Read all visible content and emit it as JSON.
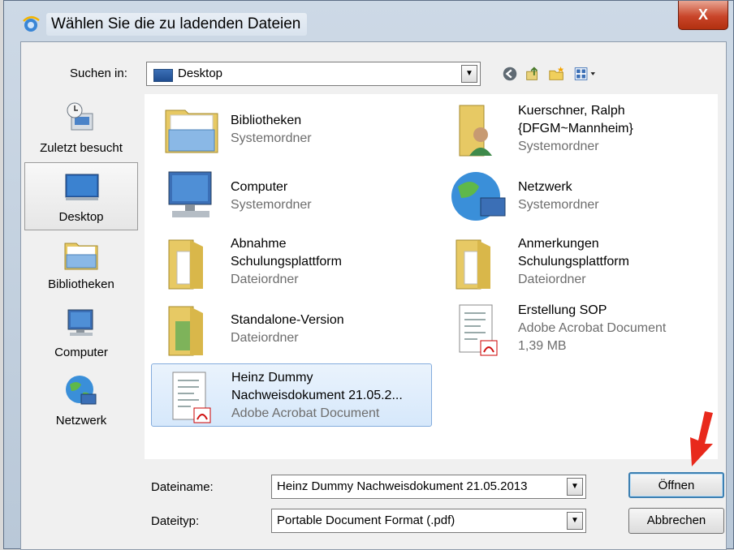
{
  "window": {
    "title": "Wählen Sie die zu ladenden Dateien",
    "close_label": "X"
  },
  "lookin": {
    "label": "Suchen in:",
    "value": "Desktop"
  },
  "toolbar": {
    "icons": [
      "back-icon",
      "up-folder-icon",
      "new-folder-icon",
      "view-menu-icon"
    ]
  },
  "places": [
    {
      "label": "Zuletzt besucht",
      "icon": "recent-places-icon"
    },
    {
      "label": "Desktop",
      "icon": "desktop-icon",
      "selected": true
    },
    {
      "label": "Bibliotheken",
      "icon": "libraries-icon"
    },
    {
      "label": "Computer",
      "icon": "computer-icon"
    },
    {
      "label": "Netzwerk",
      "icon": "network-icon"
    }
  ],
  "files": [
    {
      "name": "Bibliotheken",
      "lines": [],
      "sub": [
        "Systemordner"
      ],
      "icon": "libraries-icon"
    },
    {
      "name": "Kuerschner, Ralph",
      "lines": [
        "{DFGM~Mannheim}"
      ],
      "sub": [
        "Systemordner"
      ],
      "icon": "user-folder-icon"
    },
    {
      "name": "Computer",
      "lines": [],
      "sub": [
        "Systemordner"
      ],
      "icon": "computer-icon"
    },
    {
      "name": "Netzwerk",
      "lines": [],
      "sub": [
        "Systemordner"
      ],
      "icon": "network-icon"
    },
    {
      "name": "Abnahme",
      "lines": [
        "Schulungsplattform"
      ],
      "sub": [
        "Dateiordner"
      ],
      "icon": "folder-icon"
    },
    {
      "name": "Anmerkungen",
      "lines": [
        "Schulungsplattform"
      ],
      "sub": [
        "Dateiordner"
      ],
      "icon": "folder-icon"
    },
    {
      "name": "Standalone-Version",
      "lines": [],
      "sub": [
        "Dateiordner"
      ],
      "icon": "folder-icon"
    },
    {
      "name": "Erstellung SOP",
      "lines": [],
      "sub": [
        "Adobe Acrobat Document",
        "1,39 MB"
      ],
      "icon": "pdf-icon"
    },
    {
      "name": "Heinz Dummy",
      "lines": [
        "Nachweisdokument 21.05.2..."
      ],
      "sub": [
        "Adobe Acrobat Document"
      ],
      "icon": "pdf-icon",
      "selected": true
    }
  ],
  "filename": {
    "label": "Dateiname:",
    "value": "Heinz Dummy Nachweisdokument 21.05.2013"
  },
  "filetype": {
    "label": "Dateityp:",
    "value": "Portable Document Format (.pdf)"
  },
  "buttons": {
    "open": "Öffnen",
    "cancel": "Abbrechen"
  },
  "colors": {
    "selection": "#d6e8fb",
    "annotation_arrow": "#e8291c"
  }
}
